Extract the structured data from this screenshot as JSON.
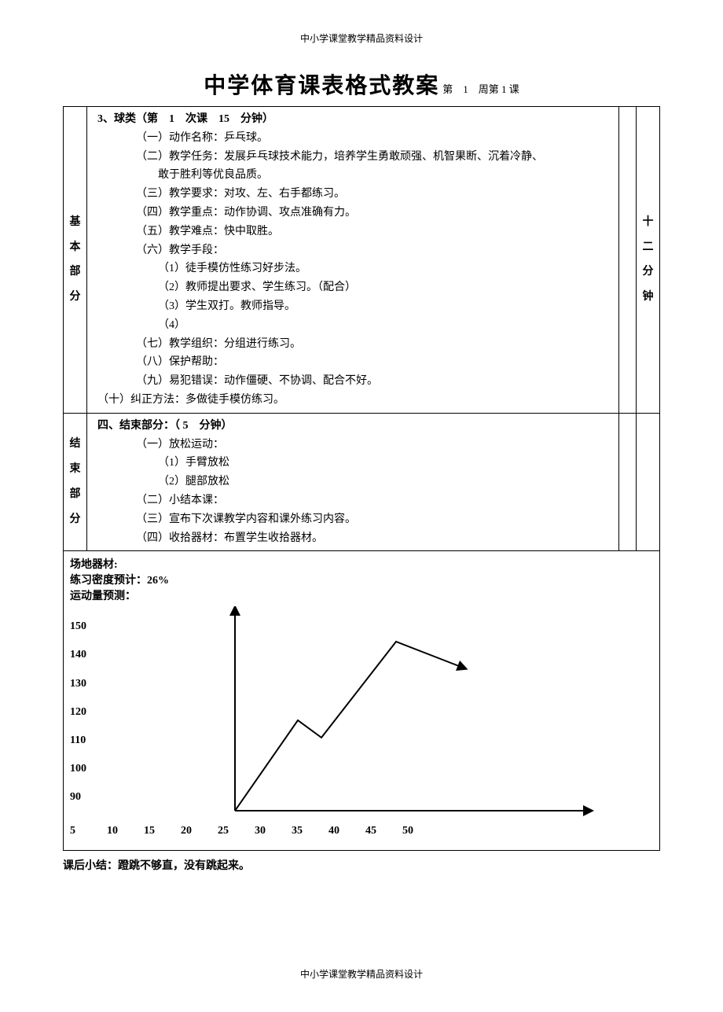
{
  "header_small": "中小学课堂教学精品资料设计",
  "title": "中学体育课表格式教案",
  "subtitle": "第　1　周第 1 课",
  "section1": {
    "vlabel": [
      "基",
      "本",
      "部",
      "分"
    ],
    "time_vlabel": [
      "十",
      "二",
      "分",
      "钟"
    ],
    "line_intro": "3、球类（第　1　次课　15　分钟）",
    "i1": "（一）动作名称：乒乓球。",
    "i2a": "（二）教学任务：发展乒乓球技术能力，培养学生勇敢顽强、机智果断、沉着冷静、",
    "i2b": "敢于胜利等优良品质。",
    "i3": "（三）教学要求：对攻、左、右手都练习。",
    "i4": "（四）教学重点：动作协调、攻点准确有力。",
    "i5": "（五）教学难点：快中取胜。",
    "i6": "（六）教学手段：",
    "i6_1": "（1）徒手模仿性练习好步法。",
    "i6_2": "（2）教师提出要求、学生练习。（配合）",
    "i6_3": "（3）学生双打。教师指导。",
    "i6_4": "（4）",
    "i7": "（七）教学组织：分组进行练习。",
    "i8": "（八）保护帮助：",
    "i9": "（九）易犯错误：动作僵硬、不协调、配合不好。",
    "i10": "（十）纠正方法：多做徒手模仿练习。"
  },
  "section2": {
    "vlabel": [
      "结",
      "束",
      "部",
      "分"
    ],
    "line_intro": "四、结束部分：（ 5　分钟）",
    "i1": "（一）放松运动：",
    "i1_1": "（1）手臂放松",
    "i1_2": "（2）腿部放松",
    "i2": "（二）小结本课：",
    "i3": "（三）宣布下次课教学内容和课外练习内容。",
    "i4": "（四）收拾器材：布置学生收拾器材。"
  },
  "bottom": {
    "l1": "场地器材:",
    "l2": "练习密度预计：26%",
    "l3": "运动量预测：",
    "y_ticks": [
      "150",
      "140",
      "130",
      "120",
      "110",
      "100",
      "90"
    ],
    "x_ticks": [
      "5",
      "10",
      "15",
      "20",
      "25",
      "30",
      "35",
      "40",
      "45",
      "50"
    ]
  },
  "chart_data": {
    "type": "line",
    "xlabel": "",
    "ylabel": "",
    "xlim": [
      5,
      60
    ],
    "ylim": [
      90,
      150
    ],
    "x_ticks": [
      5,
      10,
      15,
      20,
      25,
      30,
      35,
      40,
      45,
      50
    ],
    "y_ticks": [
      90,
      100,
      110,
      120,
      130,
      140,
      150
    ],
    "series": [
      {
        "name": "运动量预测",
        "x": [
          27,
          35,
          38,
          48,
          57
        ],
        "y": [
          90,
          118,
          112,
          146,
          137
        ]
      }
    ],
    "annotations": [
      "x-axis arrow",
      "y-axis arrow",
      "series terminal arrow"
    ]
  },
  "post_note": "课后小结：蹬跳不够直，没有跳起来。",
  "footer_small": "中小学课堂教学精品资料设计"
}
